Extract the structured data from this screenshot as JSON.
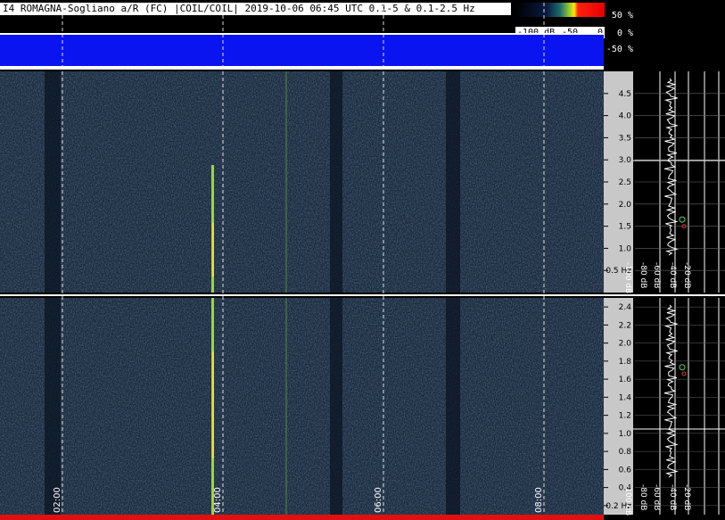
{
  "header": {
    "title": "I4 ROMAGNA-Sogliano a/R (FC) |COIL/COIL| 2019-10-06 06:45 UTC 0.1-5 & 0.1-2.5  Hz"
  },
  "colorbar": {
    "labels": [
      "-100 dB",
      "-50",
      "0"
    ],
    "colors": [
      "#000000",
      "#0a1a40",
      "#1d6c6a",
      "#8ec832",
      "#f8e800",
      "#ff2010",
      "#e60000"
    ]
  },
  "amplitude": {
    "labels": [
      "50 %",
      "0 %",
      "-50 %"
    ],
    "color": "#0a14f0"
  },
  "time_axis": {
    "labels": [
      "02:00",
      "04:00",
      "06:00",
      "08:00"
    ]
  },
  "colors": {
    "spectrogram_bg": "#1a2a3e",
    "signal": "#9fd62c",
    "grid": "#ffffff",
    "bottom_bar": "#e01010"
  },
  "chart_data": [
    {
      "type": "heatmap",
      "title": "",
      "ylim": [
        0,
        5
      ],
      "yticks": [
        "0.5 Hz",
        "1.0",
        "1.5",
        "2.0",
        "2.5",
        "3.0",
        "3.5",
        "4.0",
        "4.5"
      ],
      "spectrum_xlabels": [
        "-100 dB",
        "-80 dB",
        "-60 dB",
        "-40 dB",
        "-20 dB"
      ]
    },
    {
      "type": "heatmap",
      "title": "",
      "ylim": [
        0.1,
        2.5
      ],
      "yticks": [
        "0.2 Hz",
        "0.4",
        "0.6",
        "0.8",
        "1.0",
        "1.2",
        "1.4",
        "1.6",
        "1.8",
        "2.0",
        "2.2",
        "2.4"
      ],
      "spectrum_xlabels": [
        "-100 dB",
        "-80 dB",
        "-60 dB",
        "-40 dB",
        "-20 dB"
      ]
    }
  ]
}
